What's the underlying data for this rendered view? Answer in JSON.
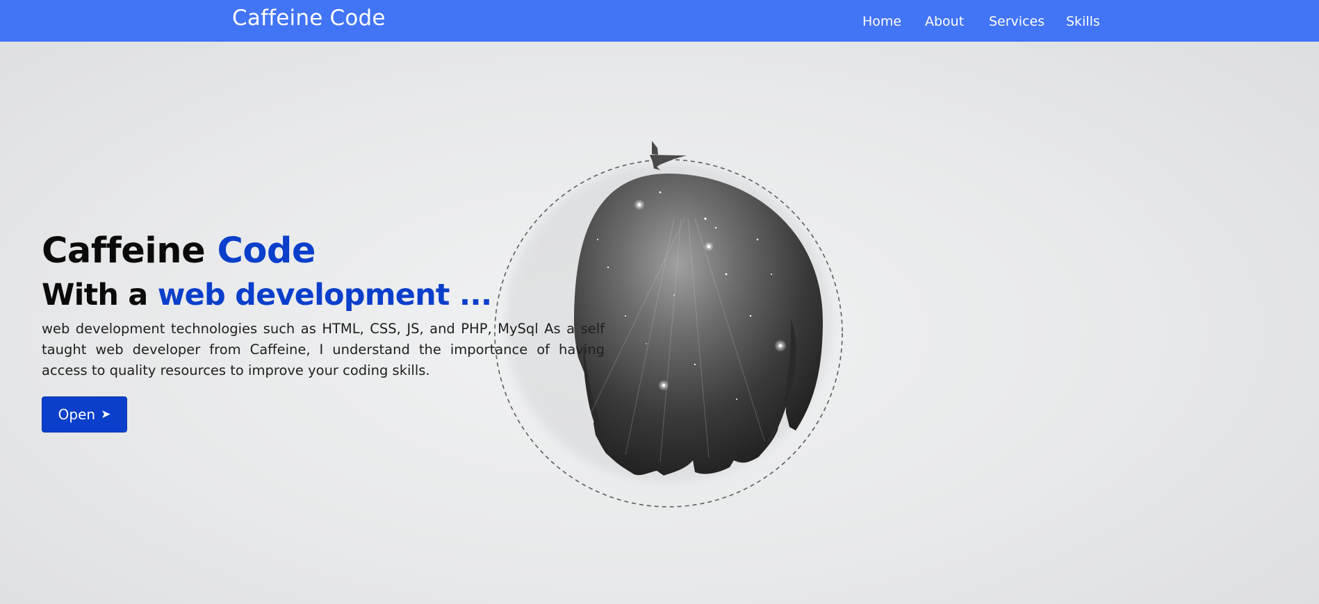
{
  "navbar": {
    "brand": "Caffeine Code",
    "links": [
      "Home",
      "About",
      "Services",
      "Skills"
    ],
    "background_color": "#4274f6"
  },
  "hero": {
    "title_part1": "Caffeine ",
    "title_accent": "Code",
    "subtitle_part1": "With a ",
    "subtitle_accent": "web development ...",
    "description": "web development technologies such as HTML, CSS, JS, and PHP, MySql As a self taught web developer from Caffeine, I understand the importance of having access to quality resources to improve your coding skills.",
    "button_label": "Open",
    "button_icon": "arrow-right-icon",
    "accent_color": "#0b3fcb"
  },
  "illustration": {
    "planet": "starry-planet-image",
    "orbit": "dashed-orbit-path",
    "ship": "spaceship-icon"
  }
}
